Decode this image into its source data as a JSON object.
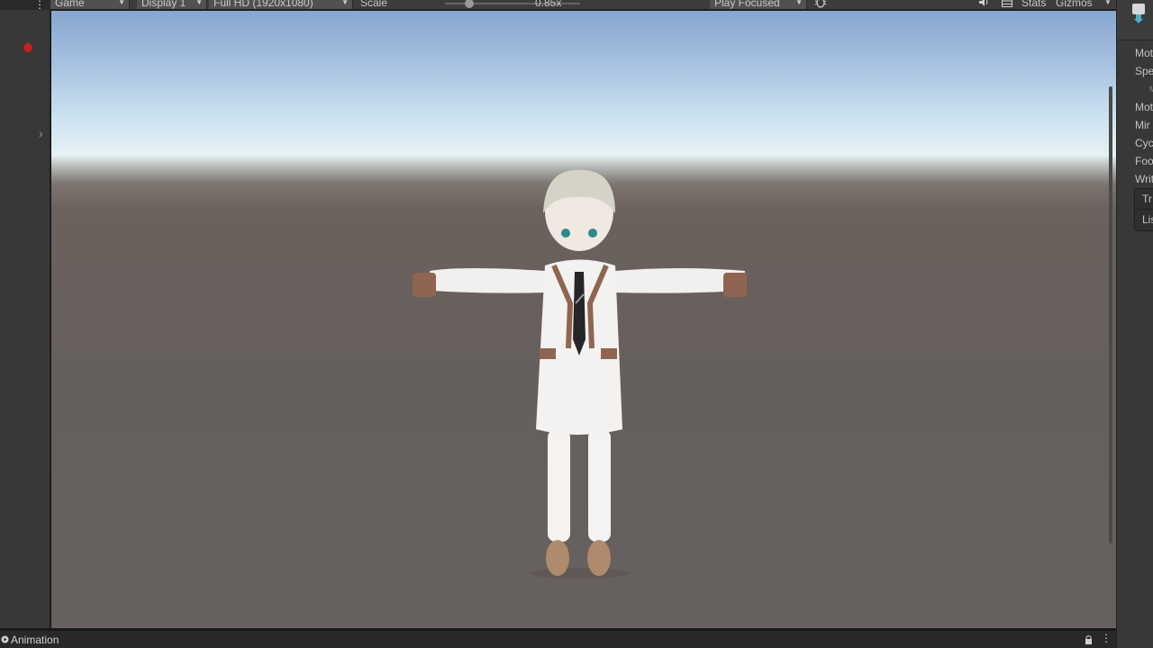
{
  "toolbar": {
    "view_select": "Game",
    "display_select": "Display 1",
    "resolution_select": "Full HD (1920x1080)",
    "scale_label": "Scale",
    "scale_value": "0.85x",
    "play_mode_select": "Play Focused",
    "stats_label": "Stats",
    "gizmos_label": "Gizmos"
  },
  "inspector": {
    "props": [
      "Mot",
      "Spe",
      "M",
      "Mot",
      "Mir",
      "Cyc",
      "Foo",
      "Writ"
    ],
    "box_rows": [
      "Tr",
      "Lis"
    ]
  },
  "bottom_tab": {
    "label": "Animation"
  },
  "colors": {
    "panel": "#383838",
    "toolbar": "#3c3c3c",
    "sky": "#a7c2e1",
    "ground": "#66605d"
  }
}
